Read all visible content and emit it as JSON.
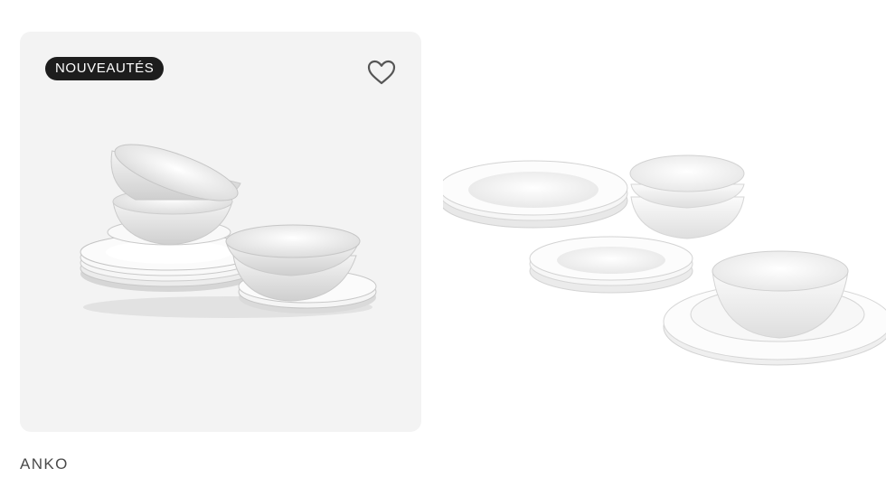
{
  "product": {
    "badge": "NOUVEAUTÉS",
    "favorite_icon": "heart-outline-icon",
    "brand": "ANKO",
    "card_background": "#f3f3f3",
    "badge_background": "#1d1d1d"
  }
}
